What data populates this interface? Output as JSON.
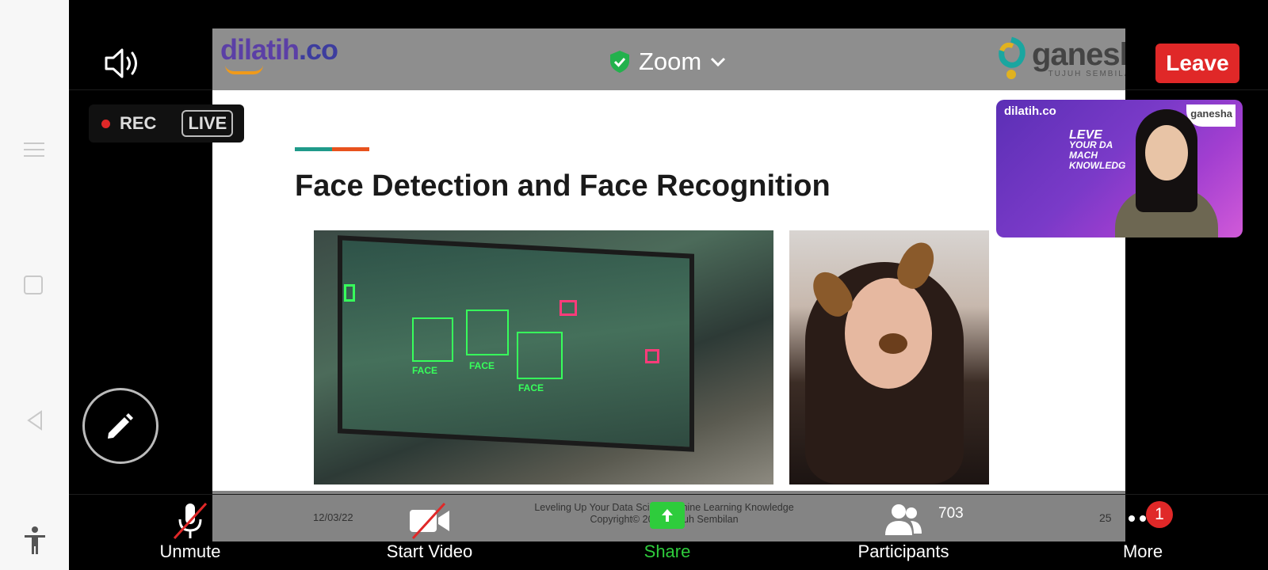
{
  "top": {
    "meeting_title": "Zoom",
    "leave_label": "Leave"
  },
  "recording": {
    "rec_label": "REC",
    "live_label": "LIVE"
  },
  "slide": {
    "brand_left": "dilatih",
    "brand_left_suffix": ".co",
    "brand_right": "ganesha",
    "brand_right_sub": "TUJUH SEMBILAN",
    "title": "Face Detection and Face Recognition",
    "face_tags": [
      "FACE",
      "FACE",
      "FACE"
    ],
    "footer_date": "12/03/22",
    "footer_line1": "Leveling Up Your Data Scien     Machine Learning Knowledge",
    "footer_line2": "Copyright© 202      a Tujuh Sembilan",
    "footer_page": "25"
  },
  "video_thumbnail": {
    "brand": "dilatih.co",
    "brand_right": "ganesha",
    "text_big": "LEVE",
    "text_lines": [
      "YOUR DA",
      "MACH",
      "KNOWLEDG"
    ]
  },
  "toolbar": {
    "unmute_label": "Unmute",
    "video_label": "Start Video",
    "share_label": "Share",
    "participants_label": "Participants",
    "participants_count": "703",
    "more_label": "More",
    "more_badge": "1"
  },
  "colors": {
    "leave_red": "#e02828",
    "share_green": "#2ecc3c",
    "face_box_green": "#37ff5b"
  }
}
